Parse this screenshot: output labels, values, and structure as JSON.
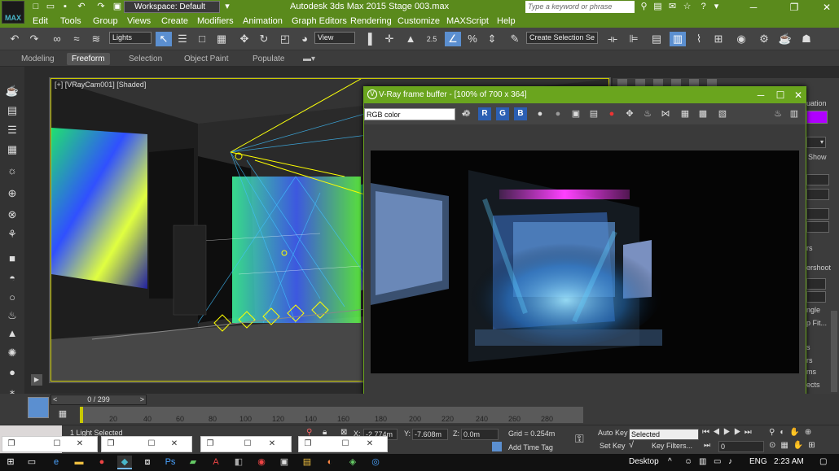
{
  "app": {
    "icon_label": "MAX",
    "title": "Autodesk 3ds Max 2015    Stage 003.max",
    "workspace": "Workspace: Default",
    "search_placeholder": "Type a keyword or phrase"
  },
  "menu": [
    "Edit",
    "Tools",
    "Group",
    "Views",
    "Create",
    "Modifiers",
    "Animation",
    "Graph Editors",
    "Rendering",
    "Customize",
    "MAXScript",
    "Help"
  ],
  "toolbar": {
    "selection_filter": "Lights",
    "reference_coord": "View",
    "named_selection": "Create Selection Se",
    "angle_snap": "2.5",
    "percent_snap": "%"
  },
  "ribbon_tabs": [
    {
      "label": "Modeling",
      "active": false
    },
    {
      "label": "Freeform",
      "active": true
    },
    {
      "label": "Selection",
      "active": false
    },
    {
      "label": "Object Paint",
      "active": false
    },
    {
      "label": "Populate",
      "active": false
    }
  ],
  "viewport": {
    "label": "[+] [VRayCam001] [Shaded]"
  },
  "vfb": {
    "title": "V-Ray frame buffer - [100% of 700 x 364]",
    "channel": "RGB color",
    "channels": [
      "R",
      "G",
      "B"
    ]
  },
  "right_panel": {
    "items": [
      "uation",
      "Show",
      "m",
      "m",
      "m",
      "m",
      "rs",
      "ershoot",
      "ngle",
      "p Fit...",
      "s",
      "rs",
      "rs",
      "ms",
      "ects",
      "ete"
    ]
  },
  "timeline": {
    "frame_counter": "0 / 299",
    "ticks": [
      "20",
      "40",
      "60",
      "80",
      "100",
      "120",
      "140",
      "160",
      "180",
      "200",
      "220",
      "240",
      "260",
      "280"
    ]
  },
  "status": {
    "selection": "1 Light Selected",
    "x_label": "X:",
    "x_value": "-2.774m",
    "y_label": "Y:",
    "y_value": "-7.608m",
    "z_label": "Z:",
    "z_value": "0.0m",
    "grid": "Grid = 0.254m",
    "add_time_tag": "Add Time Tag",
    "auto_key": "Auto Key",
    "auto_key_mode": "Selected",
    "set_key": "Set Key",
    "key_filters": "Key Filters...",
    "frame_value": "0"
  },
  "taskbar": {
    "desktop": "Desktop",
    "lang": "ENG",
    "time": "2:23 AM"
  },
  "colors": {
    "titlebar": "#5a8a1c",
    "vfb_title": "#6aa51e",
    "viewport_border": "#c8c800",
    "active_tool": "#5b8fd0",
    "swatch": "#b000ff"
  }
}
